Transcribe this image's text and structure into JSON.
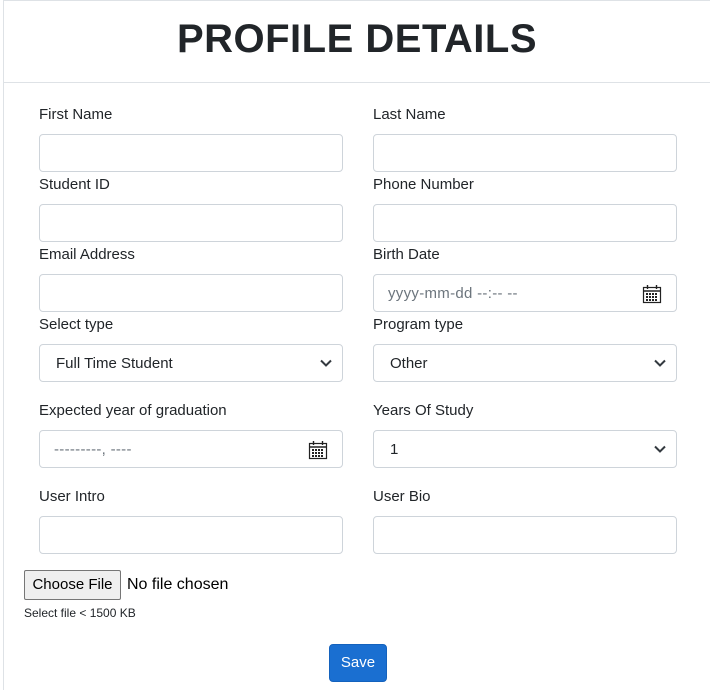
{
  "header": {
    "title": "PROFILE DETAILS"
  },
  "form": {
    "first_name": {
      "label": "First Name",
      "value": ""
    },
    "last_name": {
      "label": "Last Name",
      "value": ""
    },
    "student_id": {
      "label": "Student ID",
      "value": ""
    },
    "phone_number": {
      "label": "Phone Number",
      "value": ""
    },
    "email": {
      "label": "Email Address",
      "value": ""
    },
    "birth_date": {
      "label": "Birth Date",
      "placeholder": "yyyy-mm-dd --:-- --"
    },
    "select_type": {
      "label": "Select type",
      "selected": "Full Time Student"
    },
    "program_type": {
      "label": "Program type",
      "selected": "Other"
    },
    "graduation_year": {
      "label": "Expected year of graduation",
      "placeholder": "---------, ----"
    },
    "years_of_study": {
      "label": "Years Of Study",
      "selected": "1"
    },
    "user_intro": {
      "label": "User Intro",
      "value": ""
    },
    "user_bio": {
      "label": "User Bio",
      "value": ""
    },
    "file_upload": {
      "button_label": "Choose File",
      "status": "No file chosen",
      "hint": "Select file < 1500 KB"
    },
    "save_label": "Save"
  },
  "icons": {
    "calendar": "calendar-icon",
    "dropdown": "chevron-down-icon"
  },
  "colors": {
    "primary_button": "#1a6fd1",
    "border": "#ced4da"
  }
}
